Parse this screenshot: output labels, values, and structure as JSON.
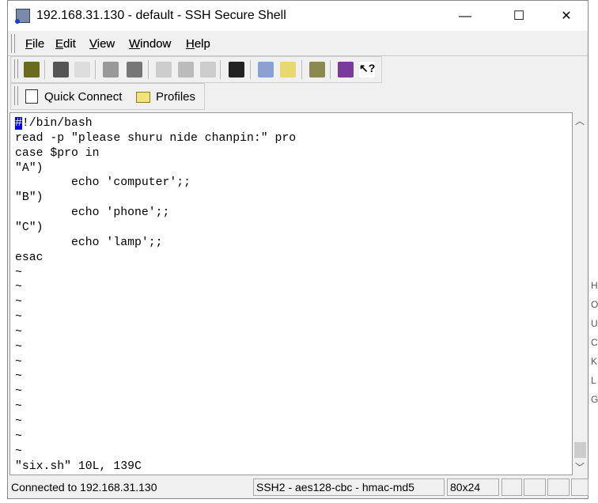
{
  "window": {
    "title": "192.168.31.130 - default - SSH Secure Shell",
    "minimize": "—",
    "maximize": "☐",
    "close": "✕"
  },
  "menu": [
    {
      "label": "File",
      "u": "F",
      "rest": "ile"
    },
    {
      "label": "Edit",
      "u": "E",
      "rest": "dit"
    },
    {
      "label": "View",
      "u": "V",
      "rest": "iew"
    },
    {
      "label": "Window",
      "u": "W",
      "rest": "indow"
    },
    {
      "label": "Help",
      "u": "H",
      "rest": "elp"
    }
  ],
  "toolbar": [
    "save-icon",
    "print-icon",
    "print-preview-icon",
    "connect-icon",
    "disconnect-icon",
    "copy-icon",
    "paste-icon",
    "paste-disabled-icon",
    "find-icon",
    "new-terminal-icon",
    "new-file-transfer-icon",
    "settings-icon",
    "help-book-icon",
    "context-help-icon"
  ],
  "quickbar": {
    "quick_connect": "Quick Connect",
    "profiles": "Profiles"
  },
  "terminal": {
    "lines": [
      "#!/bin/bash",
      "read -p \"please shuru nide chanpin:\" pro",
      "case $pro in",
      "\"A\")",
      "        echo 'computer';;",
      "\"B\")",
      "        echo 'phone';;",
      "\"C\")",
      "        echo 'lamp';;",
      "esac",
      "~",
      "~",
      "~",
      "~",
      "~",
      "~",
      "~",
      "~",
      "~",
      "~",
      "~",
      "~",
      "~",
      "\"six.sh\" 10L, 139C"
    ]
  },
  "status": {
    "connection": "Connected to 192.168.31.130",
    "cipher": "SSH2 - aes128-cbc - hmac-md5",
    "size": "80x24"
  },
  "background_letters": [
    "H",
    "O",
    "U",
    "C",
    "K",
    "L",
    "G"
  ]
}
